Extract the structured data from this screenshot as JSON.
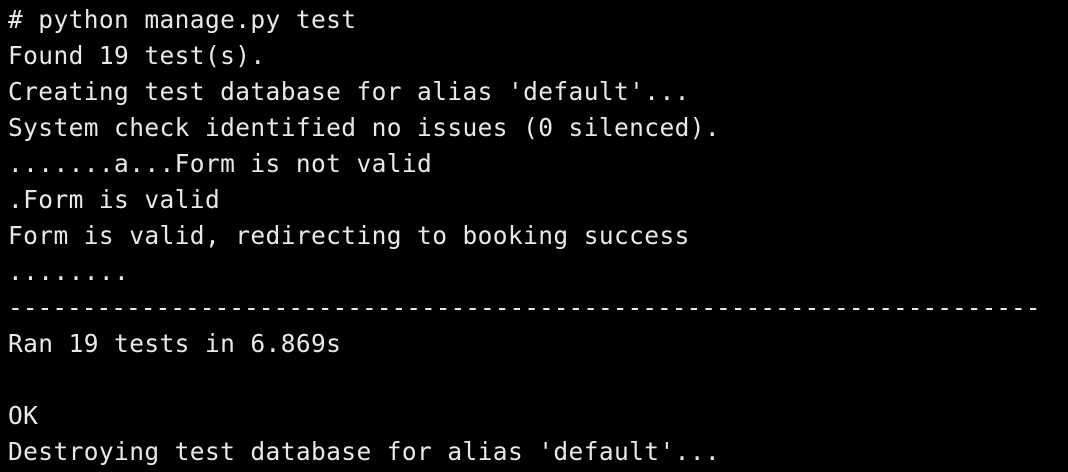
{
  "terminal": {
    "lines": [
      "# python manage.py test",
      "Found 19 test(s).",
      "Creating test database for alias 'default'...",
      "System check identified no issues (0 silenced).",
      ".......a...Form is not valid",
      ".Form is valid",
      "Form is valid, redirecting to booking success",
      "........",
      "----------------------------------------------------------------------",
      "Ran 19 tests in 6.869s",
      "",
      "OK",
      "Destroying test database for alias 'default'..."
    ],
    "colors": {
      "background": "#000000",
      "foreground": "#e8e8e8"
    }
  }
}
